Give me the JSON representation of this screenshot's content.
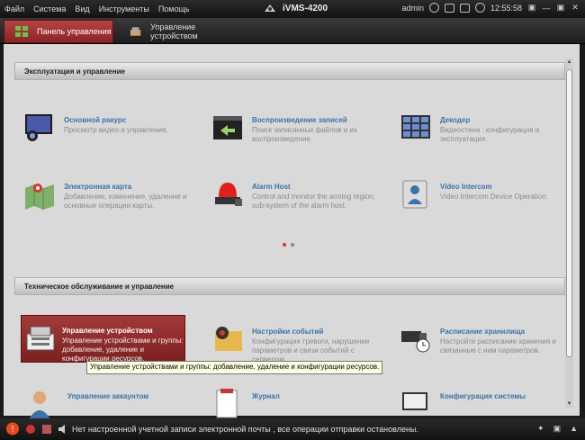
{
  "menubar": {
    "items": [
      "Файл",
      "Система",
      "Вид",
      "Инструменты",
      "Помощь"
    ],
    "app_title": "iVMS-4200",
    "user": "admin",
    "time": "12:55:58"
  },
  "tabs": [
    {
      "label": "Панель управления",
      "active": true
    },
    {
      "label": "Управление устройством",
      "active": false
    }
  ],
  "sections": [
    {
      "title": "Эксплуатация и управление"
    },
    {
      "title": "Техническое обслуживание и управление"
    }
  ],
  "ops_items": [
    {
      "title": "Основной ракурс",
      "desc": "Просмотр видео и управление.",
      "icon": "main-view-icon"
    },
    {
      "title": "Воспроизведение записей",
      "desc": "Поиск записанных файлов и их воспроизведение.",
      "icon": "playback-icon"
    },
    {
      "title": "Декодер",
      "desc": "Видеостена : конфигурация и эксплуатация.",
      "icon": "decoder-icon"
    },
    {
      "title": "Электронная карта",
      "desc": "Добавление, изменение, удаление и основные операции карты.",
      "icon": "emap-icon"
    },
    {
      "title": "Alarm Host",
      "desc": "Control and monitor the arming region, sub-system of the alarm host.",
      "icon": "alarm-host-icon"
    },
    {
      "title": "Video Intercom",
      "desc": "Video Intercom Device Operation.",
      "icon": "video-intercom-icon"
    }
  ],
  "maint_items": [
    {
      "title": "Управление устройством",
      "desc": "Управление устройствами и группы: добавление, удаление и конфигурации ресурсов.",
      "icon": "device-management-icon"
    },
    {
      "title": "Настройки событий",
      "desc": "Конфигурация тревоги, нарушение параметров и связи событий с сервером.",
      "icon": "event-settings-icon"
    },
    {
      "title": "Расписание хранилища",
      "desc": "Настройте расписание хранения и связанные с ним параметров.",
      "icon": "storage-schedule-icon"
    },
    {
      "title": "Управление аккаунтом",
      "desc": "",
      "icon": "account-icon"
    },
    {
      "title": "Журнал",
      "desc": "",
      "icon": "log-icon"
    },
    {
      "title": "Конфигурация системы",
      "desc": "",
      "icon": "system-config-icon"
    }
  ],
  "tooltip": "Управление устройствами и группы: добавление, удаление и конфигурации ресурсов.",
  "status": {
    "message": "Нет настроенной учетной записи электронной почты , все операции отправки остановлены."
  },
  "colors": {
    "accent": "#9b2d2d",
    "link": "#3d72a8",
    "panel": "#d9d9d9"
  }
}
